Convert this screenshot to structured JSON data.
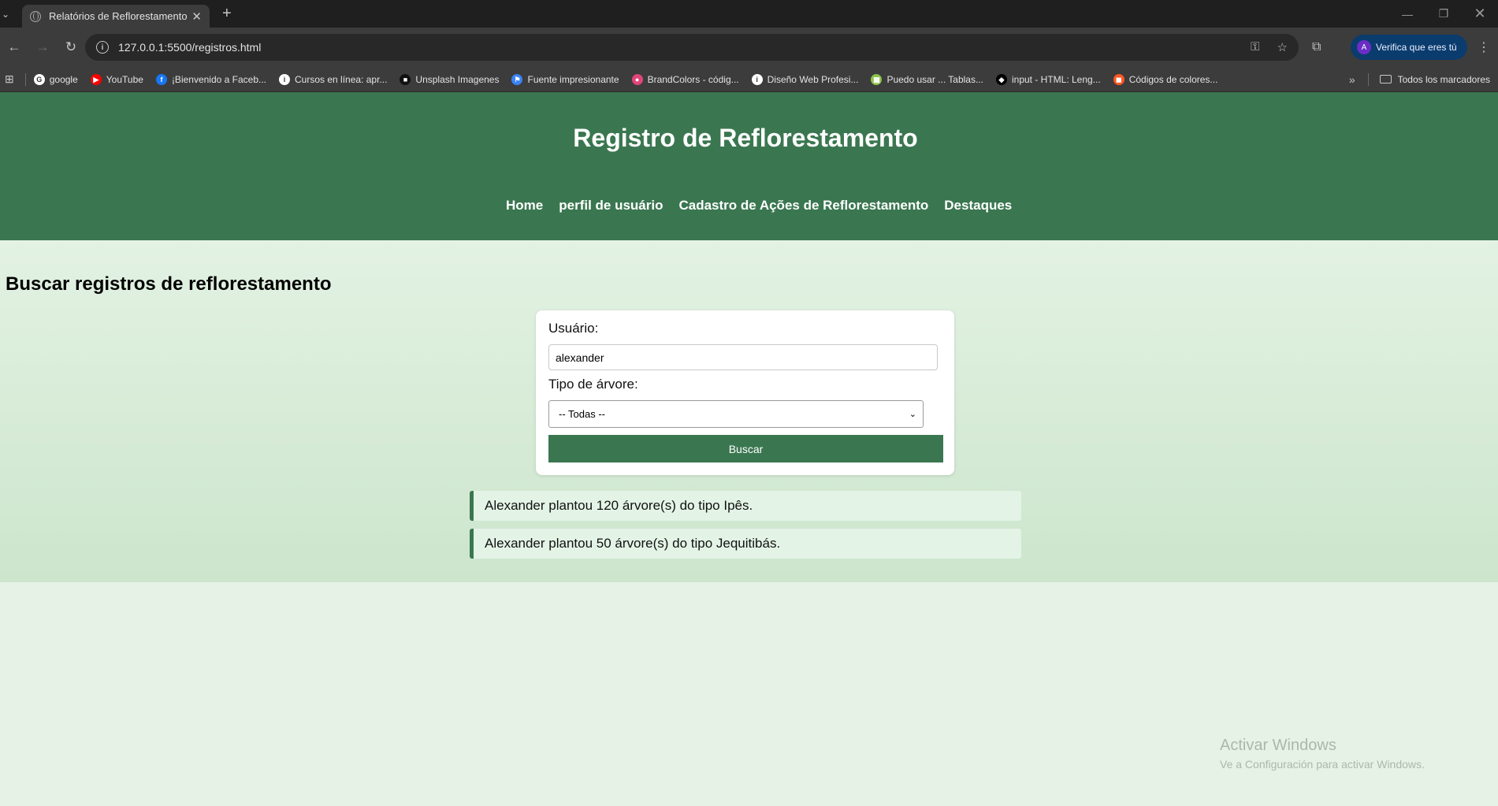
{
  "browser": {
    "tab": {
      "title": "Relatórios de Reflorestamento",
      "close_icon": "close-icon"
    },
    "url": "127.0.0.1:5500/registros.html",
    "profile_label": "Verifica que eres tú",
    "profile_initial": "A",
    "bookmarks": [
      {
        "label": "google",
        "color": "#ffffff",
        "glyph": "G"
      },
      {
        "label": "YouTube",
        "color": "#ff0000",
        "glyph": "▶"
      },
      {
        "label": "¡Bienvenido a Faceb...",
        "color": "#1877f2",
        "glyph": "f"
      },
      {
        "label": "Cursos en línea: apr...",
        "color": "#ffffff",
        "glyph": "i"
      },
      {
        "label": "Unsplash Imagenes",
        "color": "#111111",
        "glyph": "■"
      },
      {
        "label": "Fuente impresionante",
        "color": "#3b82f6",
        "glyph": "⚑"
      },
      {
        "label": "BrandColors - códig...",
        "color": "#e0457b",
        "glyph": "●"
      },
      {
        "label": "Diseño Web Profesi...",
        "color": "#ffffff",
        "glyph": "i"
      },
      {
        "label": "Puedo usar ... Tablas...",
        "color": "#8bc34a",
        "glyph": "▦"
      },
      {
        "label": "input - HTML: Leng...",
        "color": "#000000",
        "glyph": "◆"
      },
      {
        "label": "Códigos de colores...",
        "color": "#ff5722",
        "glyph": "◼"
      }
    ],
    "all_bookmarks": "Todos los marcadores"
  },
  "header": {
    "title": "Registro de Reflorestamento",
    "nav": {
      "home": "Home",
      "profile": "perfil de usuário",
      "cadastro": "Cadastro de Ações de Reflorestamento",
      "destaques": "Destaques"
    }
  },
  "search": {
    "heading": "Buscar registros de reflorestamento",
    "user_label": "Usuário:",
    "user_value": "alexander",
    "tree_label": "Tipo de árvore:",
    "tree_value": "-- Todas --",
    "button": "Buscar"
  },
  "results": [
    "Alexander plantou 120 árvore(s) do tipo Ipês.",
    "Alexander plantou 50 árvore(s) do tipo Jequitibás."
  ],
  "watermark": {
    "line1": "Activar Windows",
    "line2": "Ve a Configuración para activar Windows."
  },
  "colors": {
    "primary": "#3a7750",
    "background": "#e6f2e6"
  }
}
